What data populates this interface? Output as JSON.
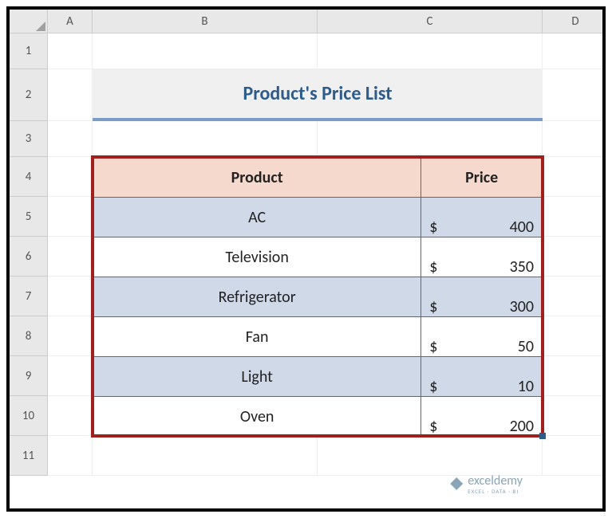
{
  "columns": [
    "A",
    "B",
    "C",
    "D"
  ],
  "rows": [
    "1",
    "2",
    "3",
    "4",
    "5",
    "6",
    "7",
    "8",
    "9",
    "10",
    "11"
  ],
  "title": "Product's Price List",
  "headers": {
    "product": "Product",
    "price": "Price"
  },
  "currency": "$",
  "chart_data": {
    "type": "table",
    "title": "Product's Price List",
    "columns": [
      "Product",
      "Price"
    ],
    "rows": [
      {
        "product": "AC",
        "price": 400
      },
      {
        "product": "Television",
        "price": 350
      },
      {
        "product": "Refrigerator",
        "price": 300
      },
      {
        "product": "Fan",
        "price": 50
      },
      {
        "product": "Light",
        "price": 10
      },
      {
        "product": "Oven",
        "price": 200
      }
    ]
  },
  "watermark": {
    "name": "exceldemy",
    "sub": "EXCEL · DATA · BI"
  }
}
